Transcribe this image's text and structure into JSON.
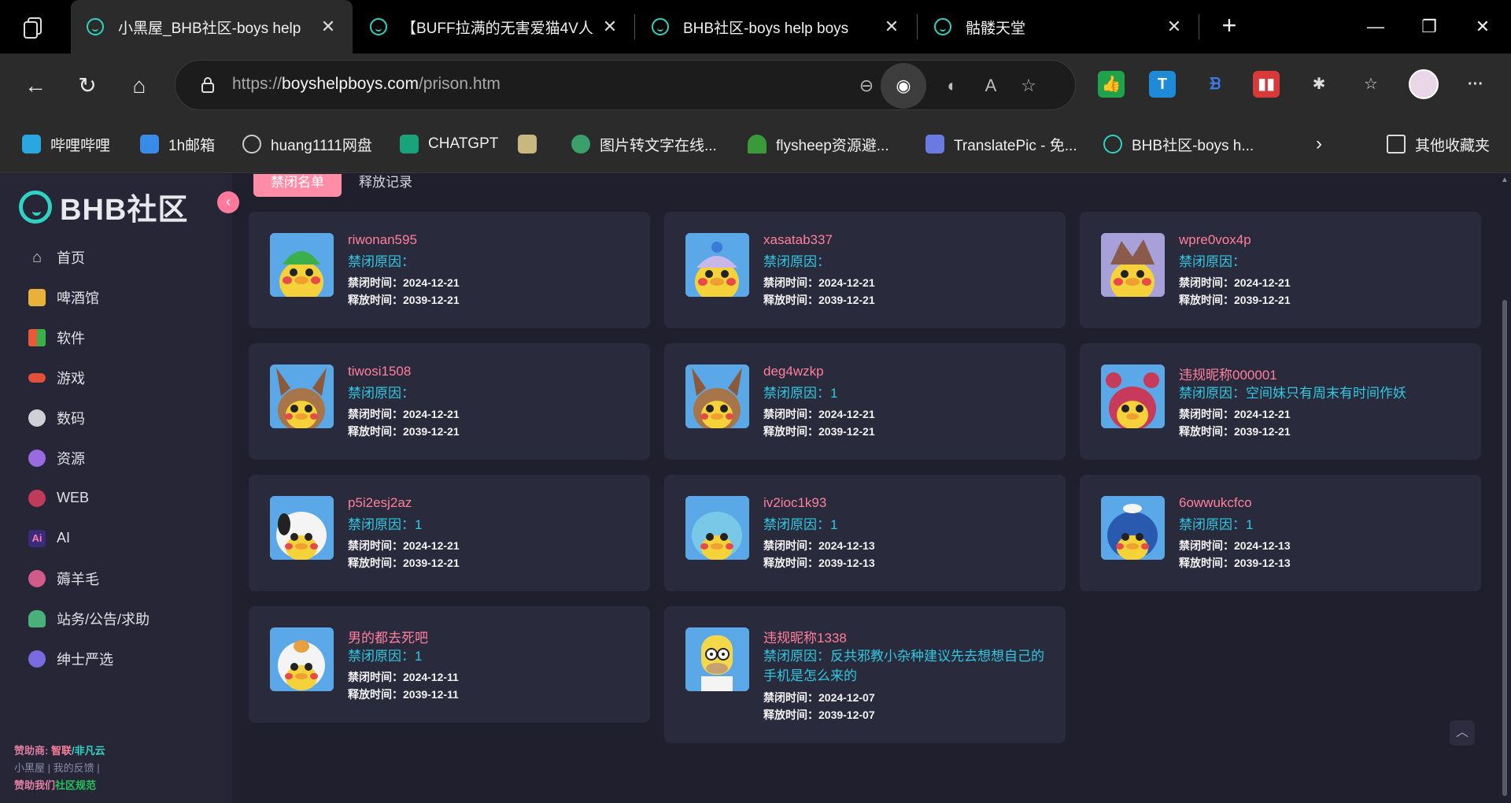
{
  "browser": {
    "tabs": [
      {
        "title": "小黑屋_BHB社区-boys help",
        "active": true
      },
      {
        "title": "【BUFF拉满的无害爱猫4V人",
        "active": false
      },
      {
        "title": "BHB社区-boys help boys",
        "active": false
      },
      {
        "title": "骷髅天堂",
        "active": false
      }
    ],
    "new_tab": "+",
    "url_prefix": "https://",
    "url_domain": "boyshelpboys.com",
    "url_path": "/prison.htm",
    "bookmarks": [
      {
        "label": "哔哩哔哩",
        "icon": "bilibili-icon"
      },
      {
        "label": "1h邮箱",
        "icon": "mail-icon"
      },
      {
        "label": "huang1111网盘",
        "icon": "cloud-icon"
      },
      {
        "label": "CHATGPT",
        "icon": "openai-icon"
      },
      {
        "label": "",
        "icon": "image-icon"
      },
      {
        "label": "图片转文字在线...",
        "icon": "ocr-icon"
      },
      {
        "label": "flysheep资源避...",
        "icon": "tree-icon"
      },
      {
        "label": "TranslatePic - 免...",
        "icon": "translate-icon"
      },
      {
        "label": "BHB社区-boys h...",
        "icon": "bhb-icon"
      }
    ],
    "other_bookmarks": "其他收藏夹"
  },
  "sidebar": {
    "logo": "BHB社区",
    "collapse": "‹",
    "items": [
      {
        "label": "首页",
        "icon": "home-icon",
        "glyph": "⌂",
        "color": "transparent"
      },
      {
        "label": "啤酒馆",
        "icon": "beer-icon",
        "glyph": "",
        "color": "#e8b23a"
      },
      {
        "label": "软件",
        "icon": "windows-icon",
        "glyph": "",
        "color": "#3a8de0"
      },
      {
        "label": "游戏",
        "icon": "gamepad-icon",
        "glyph": "",
        "color": "#e0503a"
      },
      {
        "label": "数码",
        "icon": "chat-bubble-icon",
        "glyph": "",
        "color": "#c8c8d0"
      },
      {
        "label": "资源",
        "icon": "resource-icon",
        "glyph": "",
        "color": "#9a6ae0"
      },
      {
        "label": "WEB",
        "icon": "globe-icon",
        "glyph": "",
        "color": "#c03a5a"
      },
      {
        "label": "AI",
        "icon": "ai-icon",
        "glyph": "Ai",
        "color": "#3a2a7a"
      },
      {
        "label": "薅羊毛",
        "icon": "sheep-icon",
        "glyph": "",
        "color": "#d05a8a"
      },
      {
        "label": "站务/公告/求助",
        "icon": "ufo-icon",
        "glyph": "",
        "color": "#4ab07a"
      },
      {
        "label": "绅士严选",
        "icon": "gentleman-icon",
        "glyph": "",
        "color": "#7a6ae0"
      }
    ],
    "footer": {
      "sponsor_label": "赞助商: ",
      "sponsor_a": "智联",
      "sponsor_b": "/非凡云",
      "links": "小黑屋 | 我的反馈 |",
      "support": "赞助我们",
      "rules": "社区规范"
    }
  },
  "main": {
    "tab_active": "禁闭名单",
    "tab_other": "释放记录",
    "reason_label": "禁闭原因：",
    "cards": [
      {
        "name": "riwonan595",
        "reason": "禁闭原因：",
        "ban": "禁闭时间：2024-12-21",
        "release": "释放时间：2039-12-21",
        "avatar_color": "#5aa8e8",
        "hat": "#3bb04a"
      },
      {
        "name": "xasatab337",
        "reason": "禁闭原因：",
        "ban": "禁闭时间：2024-12-21",
        "release": "释放时间：2039-12-21",
        "avatar_color": "#5aa8e8",
        "hat": "#b8a8e0"
      },
      {
        "name": "wpre0vox4p",
        "reason": "禁闭原因：",
        "ban": "禁闭时间：2024-12-21",
        "release": "释放时间：2039-12-21",
        "avatar_color": "#a8a0d8",
        "hat": "#8a5a4a"
      },
      {
        "name": "tiwosi1508",
        "reason": "禁闭原因：",
        "ban": "禁闭时间：2024-12-21",
        "release": "释放时间：2039-12-21",
        "avatar_color": "#5aa8e8",
        "hat": "#8a5a3a"
      },
      {
        "name": "deg4wzkp",
        "reason": "禁闭原因：1",
        "ban": "禁闭时间：2024-12-21",
        "release": "释放时间：2039-12-21",
        "avatar_color": "#5aa8e8",
        "hat": "#8a5a3a"
      },
      {
        "name": "违规昵称000001",
        "reason": "禁闭原因：空间妹只有周末有时间作妖",
        "ban": "禁闭时间：2024-12-21",
        "release": "释放时间：2039-12-21",
        "avatar_color": "#5aa8e8",
        "hat": "#d04a5a"
      },
      {
        "name": "p5i2esj2az",
        "reason": "禁闭原因：1",
        "ban": "禁闭时间：2024-12-21",
        "release": "释放时间：2039-12-21",
        "avatar_color": "#5aa8e8",
        "hat": "#f4f4f4"
      },
      {
        "name": "iv2ioc1k93",
        "reason": "禁闭原因：1",
        "ban": "禁闭时间：2024-12-13",
        "release": "释放时间：2039-12-13",
        "avatar_color": "#5aa8e8",
        "hat": "#7ac8e8"
      },
      {
        "name": "6owwukcfco",
        "reason": "禁闭原因：1",
        "ban": "禁闭时间：2024-12-13",
        "release": "释放时间：2039-12-13",
        "avatar_color": "#5aa8e8",
        "hat": "#2a5ab0"
      },
      {
        "name": "男的都去死吧",
        "reason": "禁闭原因：1",
        "ban": "禁闭时间：2024-12-11",
        "release": "释放时间：2039-12-11",
        "avatar_color": "#5aa8e8",
        "hat": "#f4f4f4"
      },
      {
        "name": "违规昵称1338",
        "reason": "禁闭原因：反共邪教小杂种建议先去想想自己的手机是怎么来的",
        "ban": "禁闭时间：2024-12-07",
        "release": "释放时间：2039-12-07",
        "avatar_color": "#5aa8e8",
        "hat": "#f4d84a"
      }
    ]
  },
  "colors": {
    "accent_pink": "#ff7f9d",
    "accent_cyan": "#2fc8e0",
    "card_bg": "#2a2a3d"
  }
}
